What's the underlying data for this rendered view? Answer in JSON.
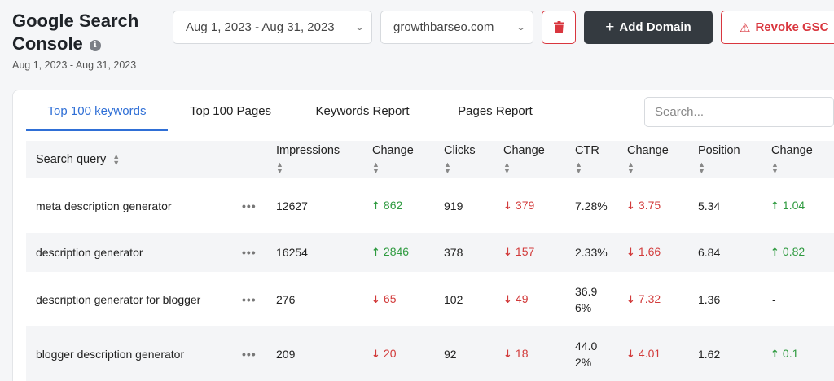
{
  "header": {
    "title_line1": "Google Search",
    "title_line2": "Console",
    "info_icon_glyph": "i",
    "subtitle": "Aug 1, 2023 - Aug 31, 2023"
  },
  "toolbar": {
    "date_range_value": "Aug 1, 2023 - Aug 31, 2023",
    "domain_value": "growthbarseo.com",
    "add_domain_label": "Add Domain",
    "add_domain_icon": "+",
    "revoke_label": "Revoke GSC",
    "revoke_icon": "⚠",
    "danger_color": "#d9363e",
    "dark_color": "#343a40"
  },
  "tabs": [
    {
      "label": "Top 100 keywords",
      "active": true
    },
    {
      "label": "Top 100 Pages",
      "active": false
    },
    {
      "label": "Keywords Report",
      "active": false
    },
    {
      "label": "Pages Report",
      "active": false
    }
  ],
  "search": {
    "placeholder": "Search..."
  },
  "table": {
    "columns": [
      "Search query",
      "Impressions",
      "Change",
      "Clicks",
      "Change",
      "CTR",
      "Change",
      "Position",
      "Change"
    ],
    "rows": [
      {
        "query": "meta description generator",
        "impressions": "12627",
        "imp_change": {
          "dir": "up",
          "value": "862"
        },
        "clicks": "919",
        "clicks_change": {
          "dir": "down",
          "value": "379"
        },
        "ctr": "7.28%",
        "ctr_change": {
          "dir": "down",
          "value": "3.75"
        },
        "position": "5.34",
        "pos_change": {
          "dir": "up",
          "value": "1.04"
        }
      },
      {
        "query": "description generator",
        "impressions": "16254",
        "imp_change": {
          "dir": "up",
          "value": "2846"
        },
        "clicks": "378",
        "clicks_change": {
          "dir": "down",
          "value": "157"
        },
        "ctr": "2.33%",
        "ctr_change": {
          "dir": "down",
          "value": "1.66"
        },
        "position": "6.84",
        "pos_change": {
          "dir": "up",
          "value": "0.82"
        }
      },
      {
        "query": "description generator for blogger",
        "impressions": "276",
        "imp_change": {
          "dir": "down",
          "value": "65"
        },
        "clicks": "102",
        "clicks_change": {
          "dir": "down",
          "value": "49"
        },
        "ctr": "36.96%",
        "ctr_change": {
          "dir": "down",
          "value": "7.32"
        },
        "position": "1.36",
        "pos_change": {
          "dir": "none",
          "value": "-"
        }
      },
      {
        "query": "blogger description generator",
        "impressions": "209",
        "imp_change": {
          "dir": "down",
          "value": "20"
        },
        "clicks": "92",
        "clicks_change": {
          "dir": "down",
          "value": "18"
        },
        "ctr": "44.02%",
        "ctr_change": {
          "dir": "down",
          "value": "4.01"
        },
        "position": "1.62",
        "pos_change": {
          "dir": "up",
          "value": "0.1"
        }
      }
    ]
  },
  "colors": {
    "accent": "#2f6fd6",
    "up": "#2e9a3f",
    "down": "#d23b3b"
  }
}
